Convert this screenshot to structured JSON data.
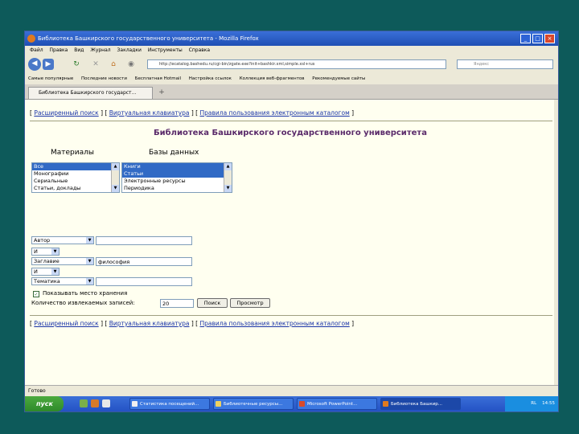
{
  "window": {
    "title": "Библиотека Башкирского государственного университета - Mozilla Firefox"
  },
  "menu": [
    "Файл",
    "Правка",
    "Вид",
    "Журнал",
    "Закладки",
    "Инструменты",
    "Справка"
  ],
  "nav": {
    "url": "http://ecatalog.bashedu.ru/cgi-bin/zgate.exe?init+bashkir.xml,simple.xsl+rus",
    "search_placeholder": "Яндекс"
  },
  "bookmarks": [
    "Самые популярные",
    "Последние новости",
    "Бесплатная Hotmail",
    "Настройка ссылок",
    "Коллекция веб-фрагментов",
    "Рекомендуемые сайты"
  ],
  "tab": {
    "label": "Библиотека Башкирского государст..."
  },
  "page": {
    "links_top": [
      "Расширенный поиск",
      "Виртуальная клавиатура",
      "Правила пользования электронным каталогом"
    ],
    "title": "Библиотека Башкирского государственного университета",
    "materials_label": "Материалы",
    "databases_label": "Базы данных",
    "materials": [
      "Все",
      "Монографии",
      "Сериальные",
      "Статьи, доклады"
    ],
    "databases": [
      "Книги",
      "Статьи",
      "Электронные ресурсы",
      "Периодика"
    ],
    "rows": [
      {
        "field": "Автор",
        "value": ""
      },
      {
        "op": "И"
      },
      {
        "field": "Заглавие",
        "value": "философия"
      },
      {
        "op": "И"
      },
      {
        "field": "Тематика",
        "value": ""
      }
    ],
    "show_location_label": "Показывать место хранения",
    "count_label": "Количество извлекаемых записей:",
    "count_value": "20",
    "search_btn": "Поиск",
    "view_btn": "Просмотр",
    "links_bottom": [
      "Расширенный поиск",
      "Виртуальная клавиатура",
      "Правила пользования электронным каталогом"
    ]
  },
  "status": "Готово",
  "taskbar": {
    "start": "пуск",
    "tasks": [
      "Статистика посещений...",
      "Библиотечные ресурсы...",
      "Microsoft PowerPoint...",
      "Библиотека Башкир..."
    ],
    "lang": "RL",
    "time": "14:55"
  }
}
